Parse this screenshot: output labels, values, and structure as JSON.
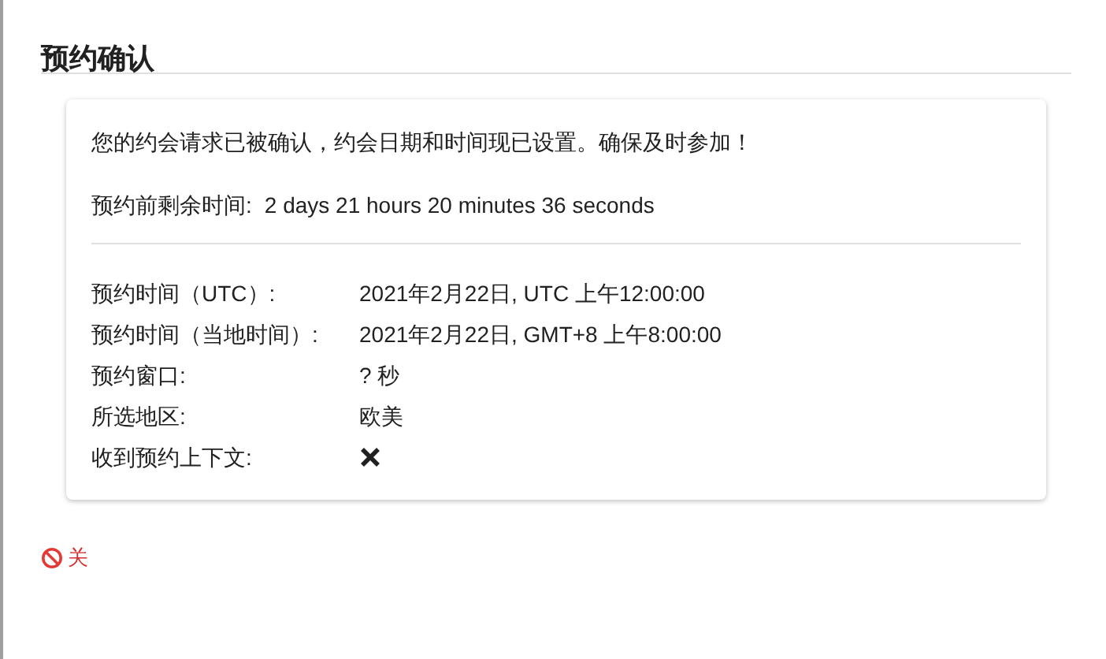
{
  "dialog": {
    "title": "预约确认"
  },
  "card": {
    "message": "您的约会请求已被确认，约会日期和时间现已设置。确保及时参加！",
    "countdown_label": "预约前剩余时间:",
    "countdown_value": "2 days 21 hours 20 minutes 36 seconds",
    "details": [
      {
        "kind": "text",
        "label": "预约时间（UTC）:",
        "value": "2021年2月22日, UTC 上午12:00:00"
      },
      {
        "kind": "text",
        "label": "预约时间（当地时间）:",
        "value": "2021年2月22日, GMT+8 上午8:00:00"
      },
      {
        "kind": "text",
        "label": "预约窗口:",
        "value": "? 秒"
      },
      {
        "kind": "text",
        "label": "所选地区:",
        "value": "欧美"
      },
      {
        "kind": "flag",
        "label": "收到预约上下文:",
        "checked": false
      }
    ]
  },
  "close_button": {
    "label": "关"
  }
}
